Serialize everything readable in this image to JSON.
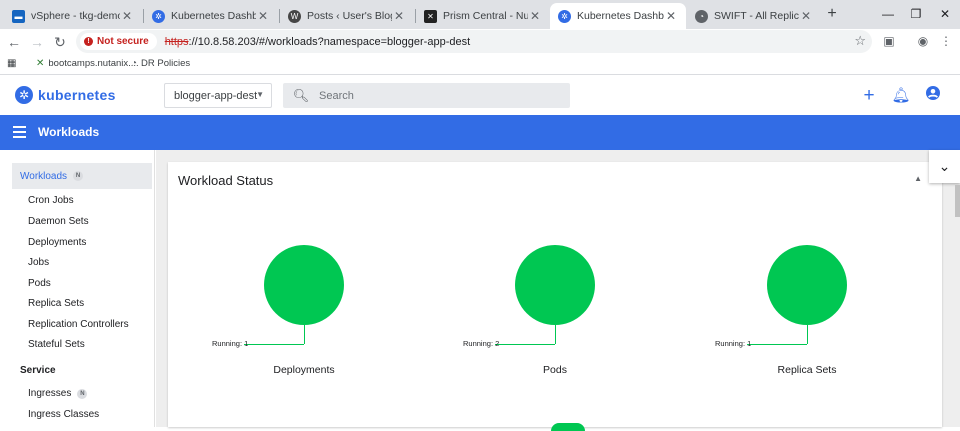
{
  "browser": {
    "tabs": [
      {
        "title": "vSphere - tkg-demo-cluste",
        "icon": "vsphere-icon",
        "color": "#1565c0",
        "active": false
      },
      {
        "title": "Kubernetes Dashboard",
        "icon": "kubernetes-icon",
        "color": "#326ce5",
        "active": false
      },
      {
        "title": "Posts ‹ User's Blog! — Word",
        "icon": "wordpress-icon",
        "color": "#464646",
        "active": false
      },
      {
        "title": "Prism Central - Nutanix",
        "icon": "nutanix-icon",
        "color": "#222222",
        "active": false
      },
      {
        "title": "Kubernetes Dashboard",
        "icon": "kubernetes-icon",
        "color": "#326ce5",
        "active": true
      },
      {
        "title": "SWIFT - All Replications",
        "icon": "swift-icon",
        "color": "#5f6368",
        "active": false
      }
    ],
    "security_label": "Not secure",
    "url_scheme": "https",
    "url_rest": "://10.8.58.203/#/workloads?namespace=blogger-app-dest",
    "bookmarks": [
      {
        "label": "bootcamps.nutanix...."
      },
      {
        "label": "DR Policies"
      }
    ]
  },
  "header": {
    "brand": "kubernetes",
    "namespace": "blogger-app-dest",
    "search_placeholder": "Search"
  },
  "titlebar": {
    "title": "Workloads"
  },
  "sidebar": {
    "active": {
      "label": "Workloads",
      "badge": "N"
    },
    "items": [
      {
        "label": "Cron Jobs"
      },
      {
        "label": "Daemon Sets"
      },
      {
        "label": "Deployments"
      },
      {
        "label": "Jobs"
      },
      {
        "label": "Pods"
      },
      {
        "label": "Replica Sets"
      },
      {
        "label": "Replication Controllers"
      },
      {
        "label": "Stateful Sets"
      }
    ],
    "section": "Service",
    "service_items": [
      {
        "label": "Ingresses",
        "badge": "N"
      },
      {
        "label": "Ingress Classes"
      }
    ]
  },
  "workload_status": {
    "title": "Workload Status",
    "stats": [
      {
        "name": "Deployments",
        "running_label": "Running: 1",
        "running": 1
      },
      {
        "name": "Pods",
        "running_label": "Running: 2",
        "running": 2
      },
      {
        "name": "Replica Sets",
        "running_label": "Running: 1",
        "running": 1
      }
    ],
    "running_color": "#00c752"
  },
  "colors": {
    "primary": "#326ce5",
    "running": "#00c752"
  }
}
